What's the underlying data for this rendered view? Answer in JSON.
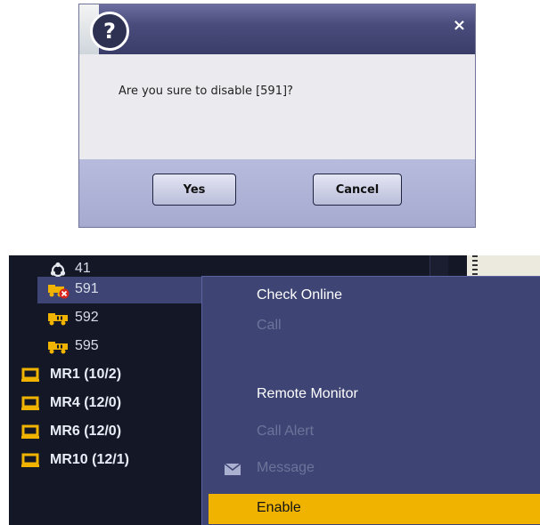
{
  "dialog": {
    "help_icon_glyph": "?",
    "close_glyph": "×",
    "message": "Are you sure to disable [591]?",
    "yes_label": "Yes",
    "cancel_label": "Cancel"
  },
  "tree": {
    "items": [
      {
        "label": "41",
        "icon": "group-circle-icon",
        "kind": "device"
      },
      {
        "label": "591",
        "icon": "truck-disabled-icon",
        "kind": "device",
        "selected": true
      },
      {
        "label": "592",
        "icon": "truck-icon",
        "kind": "device"
      },
      {
        "label": "595",
        "icon": "truck-icon",
        "kind": "device"
      },
      {
        "label": "MR1 (10/2)",
        "icon": "folder-icon",
        "kind": "group"
      },
      {
        "label": "MR4 (12/0)",
        "icon": "folder-icon",
        "kind": "group"
      },
      {
        "label": "MR6 (12/0)",
        "icon": "folder-icon",
        "kind": "group"
      },
      {
        "label": "MR10 (12/1)",
        "icon": "folder-icon",
        "kind": "group"
      }
    ]
  },
  "context_menu": {
    "items": [
      {
        "label": "Check Online",
        "state": "enabled"
      },
      {
        "label": "Call",
        "state": "disabled"
      },
      {
        "label": "Remote Monitor",
        "state": "enabled"
      },
      {
        "label": "Call Alert",
        "state": "disabled"
      },
      {
        "label": "Message",
        "state": "disabled",
        "icon": "mail-icon"
      },
      {
        "label": "Enable",
        "state": "highlighted"
      }
    ]
  },
  "colors": {
    "titlebar": "#4a4c7c",
    "tree_bg": "#141826",
    "selection": "#3e4574",
    "menu_highlight": "#f0b400",
    "folder_icon": "#f0b400"
  }
}
